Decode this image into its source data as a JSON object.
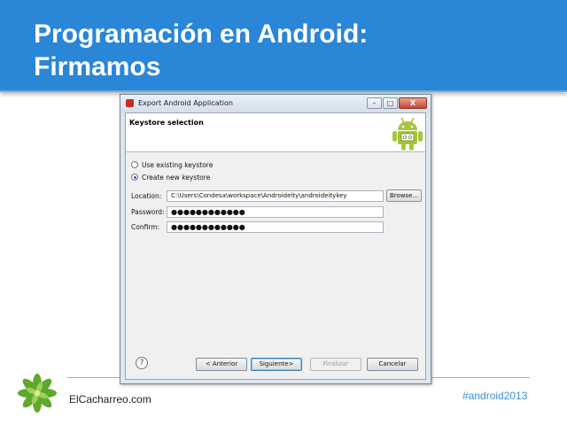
{
  "slide": {
    "title_line1": "Programación en Android:",
    "title_line2": "Firmamos"
  },
  "dialog": {
    "window_title": "Export Android Application",
    "window_buttons": {
      "minimize": "–",
      "maximize": "□",
      "close": "X"
    },
    "banner_heading": "Keystore selection",
    "radio_use_existing": "Use existing keystore",
    "radio_create_new": "Create new keystore",
    "selected_option": "create_new",
    "location_label": "Location:",
    "location_value": "C:\\Users\\Condesa\\workspace\\Androideity\\androideitykey",
    "browse_label": "Browse...",
    "password_label": "Password:",
    "password_value": "●●●●●●●●●●●●",
    "confirm_label": "Confirm:",
    "confirm_value": "●●●●●●●●●●●●",
    "help_glyph": "?",
    "back_label": "< Anterior",
    "next_label": "Siguiente>",
    "finish_label": "Finalizar",
    "cancel_label": "Cancelar"
  },
  "footer": {
    "site": "ElCacharreo.com",
    "hashtag": "#android2013"
  },
  "colors": {
    "header_blue": "#2a86d6",
    "android_green": "#a4c639",
    "hashtag_blue": "#3c8fd8"
  },
  "icons": {
    "app": "eclipse-export-icon",
    "banner": "android-robot-icon",
    "help": "help-icon",
    "footer": "green-leaf-logo"
  }
}
